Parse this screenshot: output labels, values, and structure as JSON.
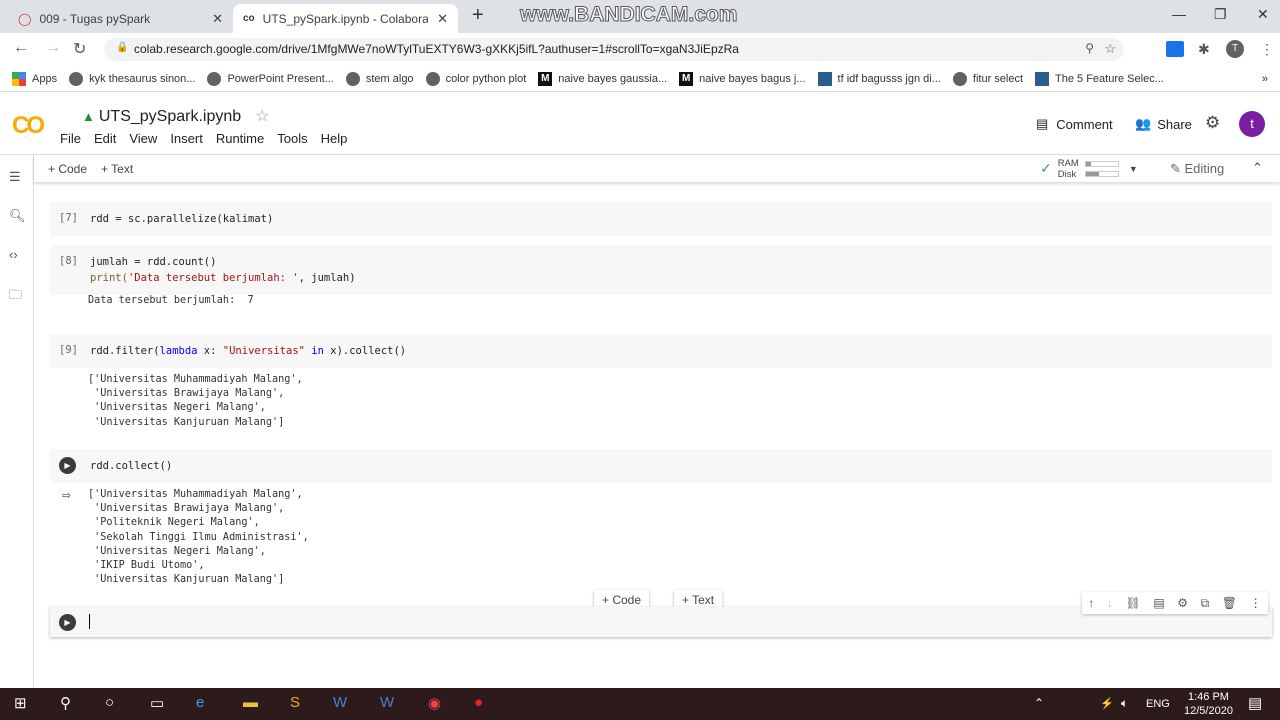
{
  "browser": {
    "tabs": [
      {
        "title": "009 - Tugas pySpark",
        "active": false
      },
      {
        "title": "UTS_pySpark.ipynb - Colaborator",
        "active": true
      }
    ],
    "watermark": "www.BANDICAM.com",
    "url": "colab.research.google.com/drive/1MfgMWe7noWTylTuEXTY6W3-gXKKj5ifL?authuser=1#scrollTo=xgaN3JiEpzRa",
    "bookmarks": [
      {
        "label": "Apps",
        "icon": "apps"
      },
      {
        "label": "kyk thesaurus sinon...",
        "icon": "globe"
      },
      {
        "label": "PowerPoint Present...",
        "icon": "globe"
      },
      {
        "label": "stem algo",
        "icon": "globe"
      },
      {
        "label": "color python plot",
        "icon": "plot"
      },
      {
        "label": "naive bayes gaussia...",
        "icon": "medium"
      },
      {
        "label": "naive bayes bagus j...",
        "icon": "medium"
      },
      {
        "label": "tf idf bagusss jgn di...",
        "icon": "tds"
      },
      {
        "label": "fitur select",
        "icon": "globe"
      },
      {
        "label": "The 5 Feature Selec...",
        "icon": "tds"
      }
    ],
    "avatar_letter": "T"
  },
  "colab": {
    "logo": "CO",
    "title": "UTS_pySpark.ipynb",
    "menu": [
      "File",
      "Edit",
      "View",
      "Insert",
      "Runtime",
      "Tools",
      "Help"
    ],
    "comment": "Comment",
    "share": "Share",
    "avatar_letter": "t",
    "add_code": "+ Code",
    "add_text": "+ Text",
    "ram": "RAM",
    "disk": "Disk",
    "ram_usage": 0.15,
    "disk_usage": 0.4,
    "editing": "Editing",
    "accent": "#7b1fa2"
  },
  "cells": [
    {
      "num": "[7]",
      "code": [
        [
          [
            "rdd = sc.parallelize(kalimat)",
            ""
          ]
        ]
      ],
      "output": []
    },
    {
      "num": "[8]",
      "code": [
        [
          [
            "jumlah = rdd.count()",
            ""
          ]
        ],
        [
          [
            "print(",
            "fn"
          ],
          [
            "'Data tersebut berjumlah: '",
            "str"
          ],
          [
            ", jumlah)",
            ""
          ]
        ]
      ],
      "output": [
        "Data tersebut berjumlah:  7"
      ]
    },
    {
      "num": "[9]",
      "code": [
        [
          [
            "rdd.filter(",
            ""
          ],
          [
            "lambda",
            "kw"
          ],
          [
            " x: ",
            ""
          ],
          [
            "\"Universitas\"",
            "str"
          ],
          [
            " ",
            ""
          ],
          [
            "in",
            "kw"
          ],
          [
            " x).collect()",
            ""
          ]
        ]
      ],
      "output": [
        "['Universitas Muhammadiyah Malang',",
        " 'Universitas Brawijaya Malang',",
        " 'Universitas Negeri Malang',",
        " 'Universitas Kanjuruan Malang']"
      ]
    },
    {
      "num": "",
      "code": [
        [
          [
            "rdd.collect()",
            ""
          ]
        ]
      ],
      "output": [
        "['Universitas Muhammadiyah Malang',",
        " 'Universitas Brawijaya Malang',",
        " 'Politeknik Negeri Malang',",
        " 'Sekolah Tinggi Ilmu Administrasi',",
        " 'Universitas Negeri Malang',",
        " 'IKIP Budi Utomo',",
        " 'Universitas Kanjuruan Malang']"
      ]
    }
  ],
  "insert": {
    "code": "+ Code",
    "text": "+ Text"
  },
  "taskbar": {
    "lang": "ENG",
    "time": "1:46 PM",
    "date": "12/5/2020"
  }
}
